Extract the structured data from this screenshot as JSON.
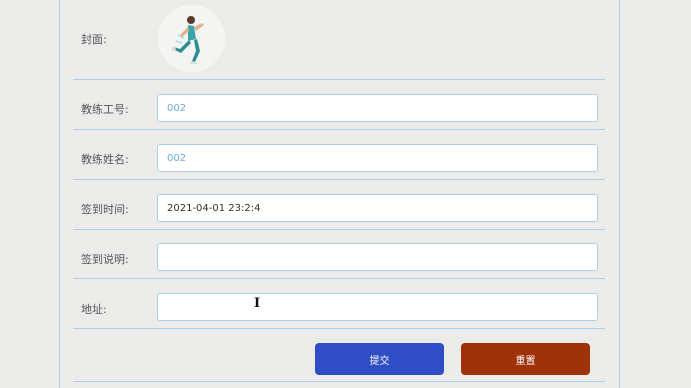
{
  "form": {
    "cover_label": "封面:",
    "coach_id_label": "教练工号:",
    "coach_id_value": "002",
    "coach_name_label": "教练姓名:",
    "coach_name_value": "002",
    "checkin_time_label": "签到时间:",
    "checkin_time_value": "2021-04-01 23:2:4",
    "checkin_note_label": "签到说明:",
    "checkin_note_value": "",
    "address_label": "地址:",
    "address_value": "",
    "submit_label": "提交",
    "reset_label": "重置"
  },
  "colors": {
    "submit_bg": "#2f4dc4",
    "reset_bg": "#a0320a",
    "border": "#a9d0ea"
  },
  "icons": {
    "cover_image": "running-woman-image",
    "text_cursor": "i-beam-cursor"
  }
}
